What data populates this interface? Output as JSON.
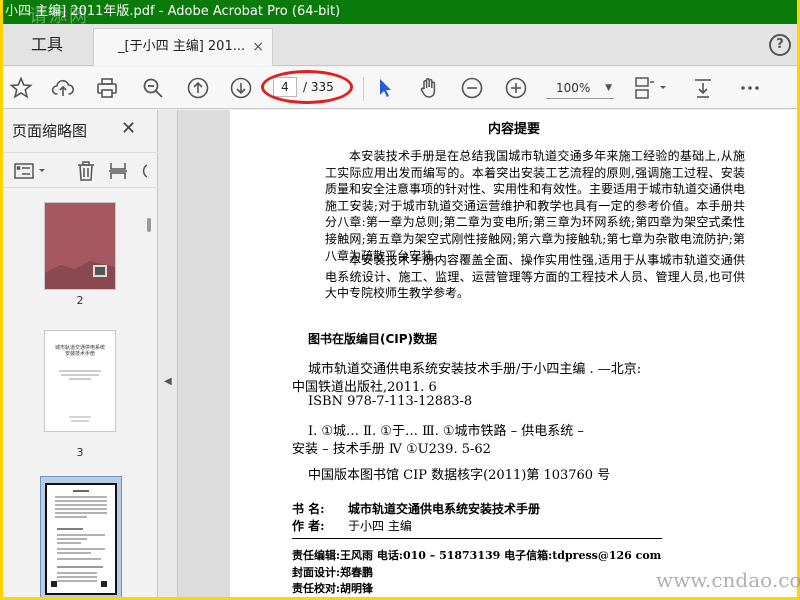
{
  "window": {
    "title": "小四 主编] 2011年版.pdf - Adobe Acrobat Pro (64-bit)",
    "watermark_top": "请添网"
  },
  "tabs": {
    "tools_label": "工具",
    "doc_label": "_[于小四 主编] 201...",
    "close_glyph": "×",
    "help_glyph": "?"
  },
  "toolbar": {
    "icons": [
      "star-icon",
      "upload-cloud-icon",
      "print-icon",
      "zoom-search-icon",
      "arrow-up-circle-icon",
      "arrow-down-circle-icon",
      "pointer-icon",
      "hand-icon",
      "zoom-out-icon",
      "zoom-in-icon",
      "page-layout-icon",
      "download-tray-icon",
      "more-icon"
    ],
    "current_page": "4",
    "total_pages": "/ 335",
    "zoom": "100%",
    "zoom_caret": "▼",
    "annotation_color": "#e02020"
  },
  "left_panel": {
    "title": "页面缩略图",
    "close_glyph": "✕",
    "thumbnails": [
      {
        "label": "2"
      },
      {
        "label": "3"
      },
      {
        "label": ""
      }
    ],
    "thumb_3_title": "城市轨道交通供电系统安装技术手册",
    "collapse_arrow": "◀"
  },
  "document": {
    "heading": "内容提要",
    "para1": "本安装技术手册是在总结我国城市轨道交通多年来施工经验的基础上,从施工实际应用出发而编写的。本着突出安装工艺流程的原则,强调施工过程、安装质量和安全注意事项的针对性、实用性和有效性。主要适用于城市轨道交通供电施工安装;对于城市轨道交通运营维护和教学也具有一定的参考价值。本手册共分八章:第一章为总则;第二章为变电所;第三章为环网系统;第四章为架空式柔性接触网;第五章为架空式刚性接触网;第六章为接触轨;第七章为杂散电流防护;第八章为疏散平台安装。",
    "para2": "本安装技术手册内容覆盖全面、操作实用性强,适用于从事城市轨道交通供电系统设计、施工、监理、运营管理等方面的工程技术人员、管理人员,也可供大中专院校师生教学参考。",
    "cip_heading": "图书在版编目(CIP)数据",
    "cip_line1": "城市轨道交通供电系统安装技术手册/于小四主编 . —北京:",
    "cip_line2": "中国铁道出版社,2011. 6",
    "cip_line3": "ISBN 978-7-113-12883-8",
    "cip_line4": "Ⅰ. ①城…   Ⅱ. ①于…   Ⅲ. ①城市铁路 – 供电系统 –",
    "cip_line5": "安装 – 技术手册   Ⅳ  ①U239. 5-62",
    "cip_line6": "中国版本图书馆 CIP 数据核字(2011)第 103760 号",
    "book_label": "书     名:",
    "book_value": "城市轨道交通供电系统安装技术手册",
    "author_label": "作     者:",
    "author_value": "于小四   主编",
    "editor_line": "责任编辑:王风雨     电话:010 – 51873139     电子信箱:tdpress@126  com",
    "cover_line": "封面设计:郑春鹏",
    "proof_line": "责任校对:胡明锋"
  },
  "watermark_bottom": "www.cndao.com"
}
